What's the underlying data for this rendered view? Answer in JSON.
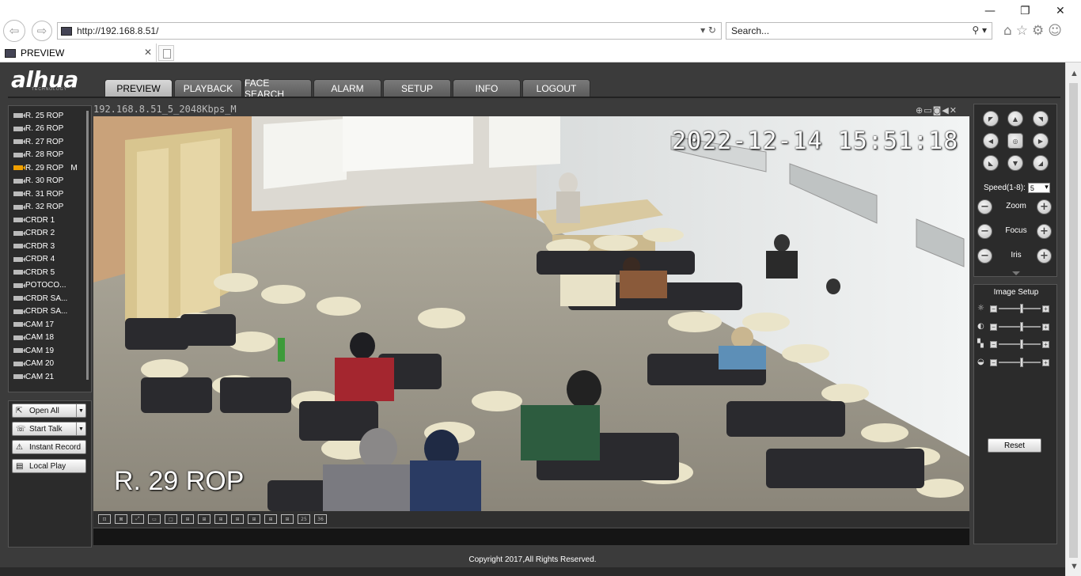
{
  "browser": {
    "url": "http://192.168.8.51/",
    "search_placeholder": "Search...",
    "tab_title": "PREVIEW",
    "win_minimize": "—",
    "win_restore": "❐",
    "win_close": "✕",
    "back": "⇦",
    "forward": "⇨",
    "addr_controls": "▾ ↻",
    "search_controls": "⚲ ▾",
    "tab_close": "✕",
    "toolbar_icons": "⌂☆⚙☺"
  },
  "app": {
    "logo": "alhua",
    "logo_sub": "TECHNOLOGY",
    "menu": [
      "PREVIEW",
      "PLAYBACK",
      "FACE SEARCH",
      "ALARM",
      "SETUP",
      "INFO",
      "LOGOUT"
    ],
    "active_menu": "PREVIEW",
    "channels": [
      {
        "label": "R. 25 ROP",
        "active": false
      },
      {
        "label": "R. 26 ROP",
        "active": false
      },
      {
        "label": "R. 27 ROP",
        "active": false
      },
      {
        "label": "R. 28 ROP",
        "active": false
      },
      {
        "label": "R. 29 ROP",
        "active": true,
        "stream": "M"
      },
      {
        "label": "R. 30 ROP",
        "active": false
      },
      {
        "label": "R. 31 ROP",
        "active": false
      },
      {
        "label": "R. 32 ROP",
        "active": false
      },
      {
        "label": "CRDR 1",
        "active": false
      },
      {
        "label": "CRDR 2",
        "active": false
      },
      {
        "label": "CRDR 3",
        "active": false
      },
      {
        "label": "CRDR 4",
        "active": false
      },
      {
        "label": "CRDR 5",
        "active": false
      },
      {
        "label": "POTOCO...",
        "active": false
      },
      {
        "label": "CRDR SA...",
        "active": false
      },
      {
        "label": "CRDR SA...",
        "active": false
      },
      {
        "label": "CAM 17",
        "active": false
      },
      {
        "label": "CAM 18",
        "active": false
      },
      {
        "label": "CAM 19",
        "active": false
      },
      {
        "label": "CAM 20",
        "active": false
      },
      {
        "label": "CAM 21",
        "active": false
      }
    ],
    "controls": {
      "open_all": "Open All",
      "start_talk": "Start Talk",
      "instant_record": "Instant Record",
      "local_play": "Local Play",
      "open_all_icon": "⇱",
      "start_talk_icon": "☏",
      "instant_record_icon": "⚠",
      "local_play_icon": "▤",
      "dropdown_arrow": "▼"
    },
    "video": {
      "title": "192.168.8.51_5_2048Kbps_M",
      "osd_time": "2022-12-14 15:51:18",
      "osd_name": "R. 29 ROP",
      "tool_icons": "⊕▭◙◀✕"
    },
    "layout_buttons": [
      "⊡",
      "⊠",
      "⤢",
      "▭",
      "□",
      "⊞",
      "⊞",
      "⊞",
      "⊞",
      "⊞",
      "⊞",
      "⊞",
      "25",
      "36"
    ],
    "ptz": {
      "speed_label": "Speed(1-8):",
      "speed_value": "5",
      "zoom": "Zoom",
      "focus": "Focus",
      "iris": "Iris",
      "minus": "−",
      "plus": "+",
      "dir_up_left": "◤",
      "dir_up": "▲",
      "dir_up_right": "◥",
      "dir_left": "◀",
      "dir_center": "◎",
      "dir_right": "▶",
      "dir_down_left": "◣",
      "dir_down": "▼",
      "dir_down_right": "◢"
    },
    "image_setup": {
      "title": "Image Setup",
      "reset": "Reset",
      "sliders": [
        {
          "name": "brightness",
          "icon": "☼",
          "level": 0.55
        },
        {
          "name": "contrast",
          "icon": "◐",
          "level": 0.55
        },
        {
          "name": "saturation",
          "icon": "▚",
          "level": 0.55
        },
        {
          "name": "hue",
          "icon": "◒",
          "level": 0.55
        }
      ],
      "slider_minus": "−",
      "slider_plus": "+"
    },
    "copyright": "Copyright 2017,All Rights Reserved."
  },
  "scroll": {
    "up": "▲",
    "down": "▼"
  }
}
